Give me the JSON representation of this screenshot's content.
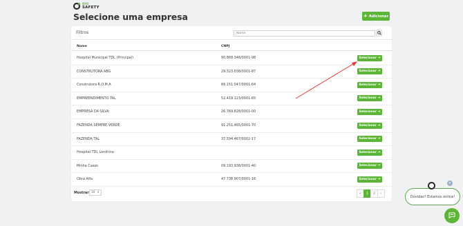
{
  "brand": {
    "line1": "DIO",
    "line2": "SAFETY"
  },
  "header": {
    "title": "Selecione uma empresa",
    "add_label": "Adicionar"
  },
  "filters": {
    "title": "Filtros",
    "search_placeholder": "Nome"
  },
  "table": {
    "columns": [
      "Nome",
      "CNPJ"
    ],
    "select_label": "Selecionar",
    "rows": [
      {
        "name": "Hospital Municipal TDL (Principal)",
        "cnpj": "90.868.348/0001-98"
      },
      {
        "name": "CONSTRUTORA ABG",
        "cnpj": "29.323.038/0001-87"
      },
      {
        "name": "Construtora R.O.M.A",
        "cnpj": "66.151.047/0001-64"
      },
      {
        "name": "EMPREENDIMENTO TAL",
        "cnpj": "52.419.123/0001-65"
      },
      {
        "name": "EMPRESA DA SILVA",
        "cnpj": "26.769.828/0001-00"
      },
      {
        "name": "FAZENDA SEMPRE VERDE",
        "cnpj": "91.251.465/0001-70"
      },
      {
        "name": "FAZENDA TAL",
        "cnpj": "37.594.467/0002-17"
      },
      {
        "name": "Hospital TDL Londrina",
        "cnpj": ""
      },
      {
        "name": "Minha Casas",
        "cnpj": "09.193.938/0001-40"
      },
      {
        "name": "Obra Alfa",
        "cnpj": "47.738.907/0001-16"
      }
    ]
  },
  "footer": {
    "show_label": "Mostrar",
    "per_page": "10",
    "pagination": {
      "first": "«",
      "pages": [
        "1",
        "2"
      ],
      "next": "›",
      "active": "1"
    }
  },
  "chat": {
    "message": "Dúvidas? Estamos online!",
    "close": "×"
  },
  "colors": {
    "primary": "#5cb536",
    "annotation": "#e53935"
  },
  "icons": [
    "plus-icon",
    "search-icon",
    "arrow-right-icon",
    "chat-icon",
    "close-icon"
  ]
}
